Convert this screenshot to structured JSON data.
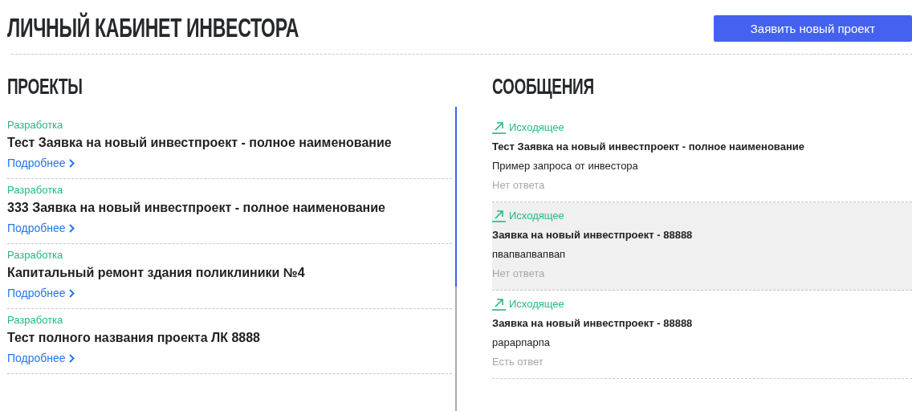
{
  "page_title": "ЛИЧНЫЙ КАБИНЕТ ИНВЕСТОРА",
  "new_project_button": "Заявить новый проект",
  "projects": {
    "heading": "ПРОЕКТЫ",
    "items": [
      {
        "status": "Разработка",
        "title": "Тест Заявка на новый инвестпроект - полное наименование",
        "link": "Подробнее"
      },
      {
        "status": "Разработка",
        "title": "333 Заявка на новый инвестпроект - полное наименование",
        "link": "Подробнее"
      },
      {
        "status": "Разработка",
        "title": "Капитальный ремонт здания поликлиники №4",
        "link": "Подробнее"
      },
      {
        "status": "Разработка",
        "title": "Тест полного названия проекта ЛК 8888",
        "link": "Подробнее"
      }
    ]
  },
  "messages": {
    "heading": "СООБЩЕНИЯ",
    "items": [
      {
        "direction": "Исходящее",
        "subject": "Тест Заявка на новый инвестпроект - полное наименование",
        "body": "Пример запроса от инвестора",
        "reply_status": "Нет ответа",
        "selected": false
      },
      {
        "direction": "Исходящее",
        "subject": "Заявка на новый инвестпроект - 88888",
        "body": "пвапвапвапвап",
        "reply_status": "Нет ответа",
        "selected": true
      },
      {
        "direction": "Исходящее",
        "subject": "Заявка на новый инвестпроект - 88888",
        "body": "рарарпарпа",
        "reply_status": "Есть ответ",
        "selected": false
      }
    ]
  }
}
